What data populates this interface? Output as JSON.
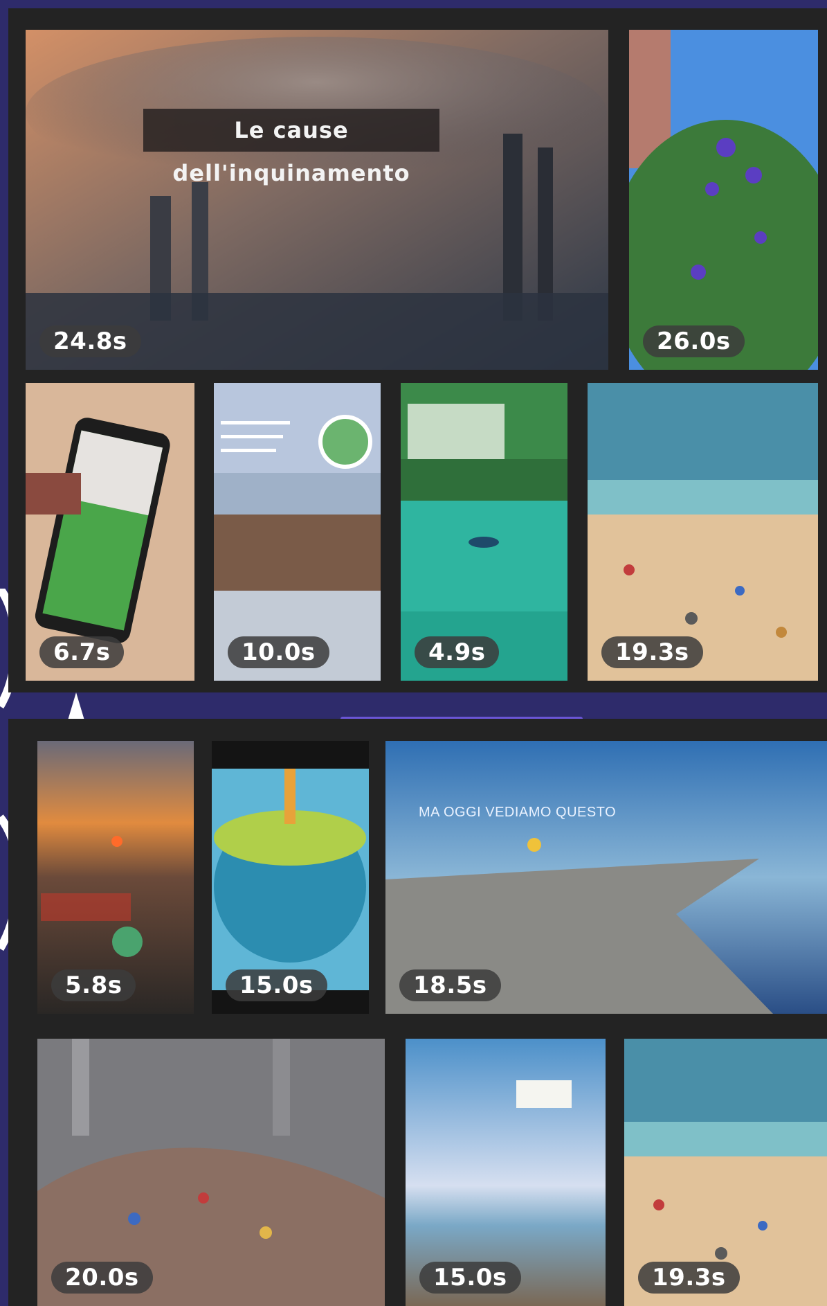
{
  "colors": {
    "background": "#2e2b6b",
    "panel": "#232323",
    "accent": "#6a55d6"
  },
  "top_section": {
    "tiles": [
      {
        "duration": "24.8s",
        "caption": "Le cause dell'inquinamento"
      },
      {
        "duration": "26.0s"
      },
      {
        "duration": "6.7s"
      },
      {
        "duration": "10.0s"
      },
      {
        "duration": "4.9s"
      },
      {
        "duration": "19.3s"
      }
    ]
  },
  "bottom_section": {
    "tiles": [
      {
        "duration": "5.8s"
      },
      {
        "duration": "15.0s"
      },
      {
        "duration": "18.5s",
        "caption": "MA OGGI VEDIAMO QUESTO"
      },
      {
        "duration": "20.0s"
      },
      {
        "duration": "15.0s"
      },
      {
        "duration": "19.3s"
      }
    ]
  }
}
